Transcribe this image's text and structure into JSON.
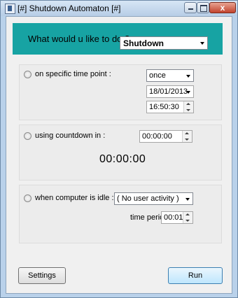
{
  "window": {
    "title": "[#] Shutdown Automaton [#]",
    "close_glyph": "x"
  },
  "header": {
    "prompt": "What would u like to do ?",
    "action_selected": "Shutdown"
  },
  "specific_time": {
    "label": "on specific time point :",
    "repeat_selected": "once",
    "date_value": "18/01/2013",
    "time_value": "16:50:30"
  },
  "countdown": {
    "label": "using countdown in :",
    "input_value": "00:00:00",
    "display": "00:00:00"
  },
  "idle": {
    "label": "when computer is idle :",
    "mode_selected": "( No user activity )",
    "period_label": "time period :",
    "period_value": "00:01"
  },
  "buttons": {
    "settings": "Settings",
    "run": "Run"
  },
  "icons": {
    "app": "app-icon",
    "minimize": "minimize-icon",
    "maximize": "maximize-icon",
    "close": "close-icon"
  }
}
